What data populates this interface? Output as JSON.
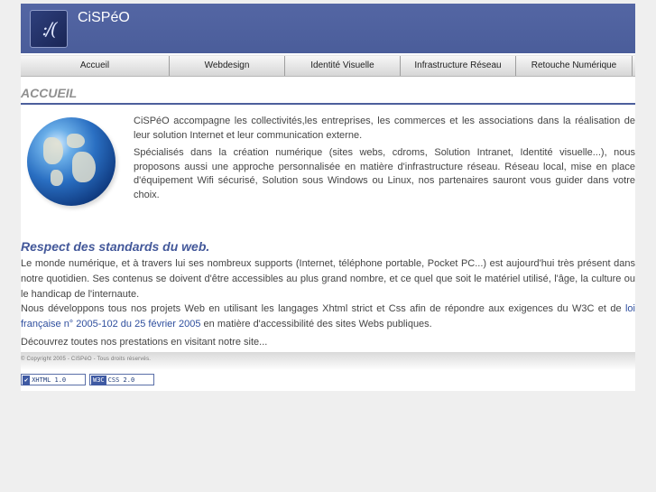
{
  "header": {
    "site_name": "CiSPéO",
    "logo_text": ":/("
  },
  "nav": {
    "items": [
      "Accueil",
      "Webdesign",
      "Identité Visuelle",
      "Infrastructure Réseau",
      "Retouche Numérique"
    ]
  },
  "page_title": "ACCUEIL",
  "intro": {
    "p1": "CiSPéO accompagne les collectivités,les entreprises, les commerces et les associations dans la réalisation de leur solution Internet et leur communication externe.",
    "p2": "Spécialisés dans la création numérique (sites webs, cdroms, Solution Intranet, Identité visuelle...), nous proposons aussi une approche personnalisée en matière d'infrastructure réseau. Réseau local, mise en place d'équipement Wifi sécurisé, Solution sous Windows ou Linux, nos partenaires sauront vous guider dans votre choix."
  },
  "standards": {
    "heading": "Respect des standards du web.",
    "p1": "Le monde numérique, et à travers lui ses nombreux supports (Internet, téléphone portable, Pocket PC...) est aujourd'hui très présent dans notre quotidien. Ses contenus se doivent d'être accessibles au plus grand nombre, et ce quel que soit le matériel utilisé, l'âge, la culture ou le handicap de l'internaute.",
    "p2_before": "Nous développons tous nos projets Web en utilisant les langages Xhtml strict et Css afin de répondre aux exigences du W3C et de ",
    "p2_link": "loi française n° 2005-102 du 25 février 2005",
    "p2_after": " en matière d'accessibilité des sites Webs publiques.",
    "p3": "Découvrez toutes nos prestations en visitant notre site..."
  },
  "footer": {
    "copyright": "© Copyright 2005 - CiSPéO - Tous droits réservés.",
    "badge_xhtml": "XHTML 1.0",
    "badge_css_tag": "W3C",
    "badge_css": "CSS 2.0"
  },
  "colors": {
    "header_blue": "#4a5d9a",
    "title_gray": "#909090",
    "heading_blue": "#43589a",
    "link_blue": "#2f4f9e"
  }
}
